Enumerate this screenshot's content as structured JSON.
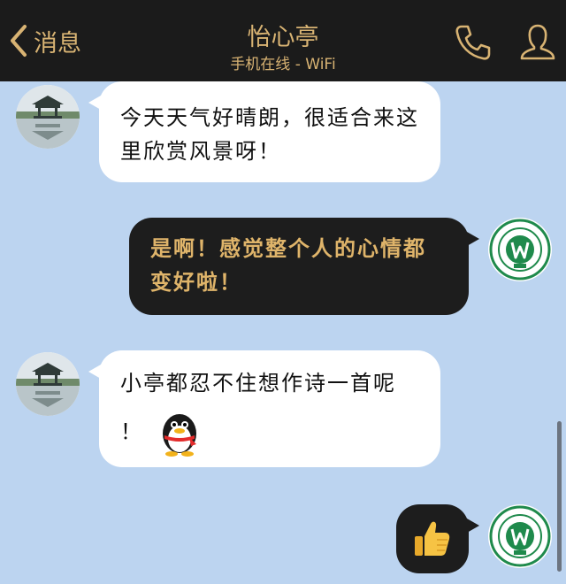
{
  "header": {
    "back_label": "消息",
    "title": "怡心亭",
    "status": "手机在线 - WiFi",
    "accent_color": "#d8b373",
    "icons": [
      "chevron-left-icon",
      "phone-icon",
      "person-icon"
    ]
  },
  "messages": [
    {
      "side": "in",
      "text": "今天天气好晴朗，很适合来这里欣赏风景呀！",
      "avatar": "pavilion-avatar"
    },
    {
      "side": "out",
      "text": "是啊！感觉整个人的心情都变好啦！",
      "avatar": "university-logo-avatar"
    },
    {
      "side": "in",
      "text_line1": "小亭都忍不住想作诗一首呢",
      "text_line2": "！",
      "emoji": "penguin-emoji",
      "avatar": "pavilion-avatar"
    },
    {
      "side": "out",
      "emoji": "thumbs-up-emoji",
      "avatar": "university-logo-avatar"
    }
  ],
  "colors": {
    "chat_background": "#bcd4f0",
    "incoming_bubble": "#ffffff",
    "outgoing_bubble": "#1d1d1d",
    "outgoing_text": "#dfb46a"
  }
}
